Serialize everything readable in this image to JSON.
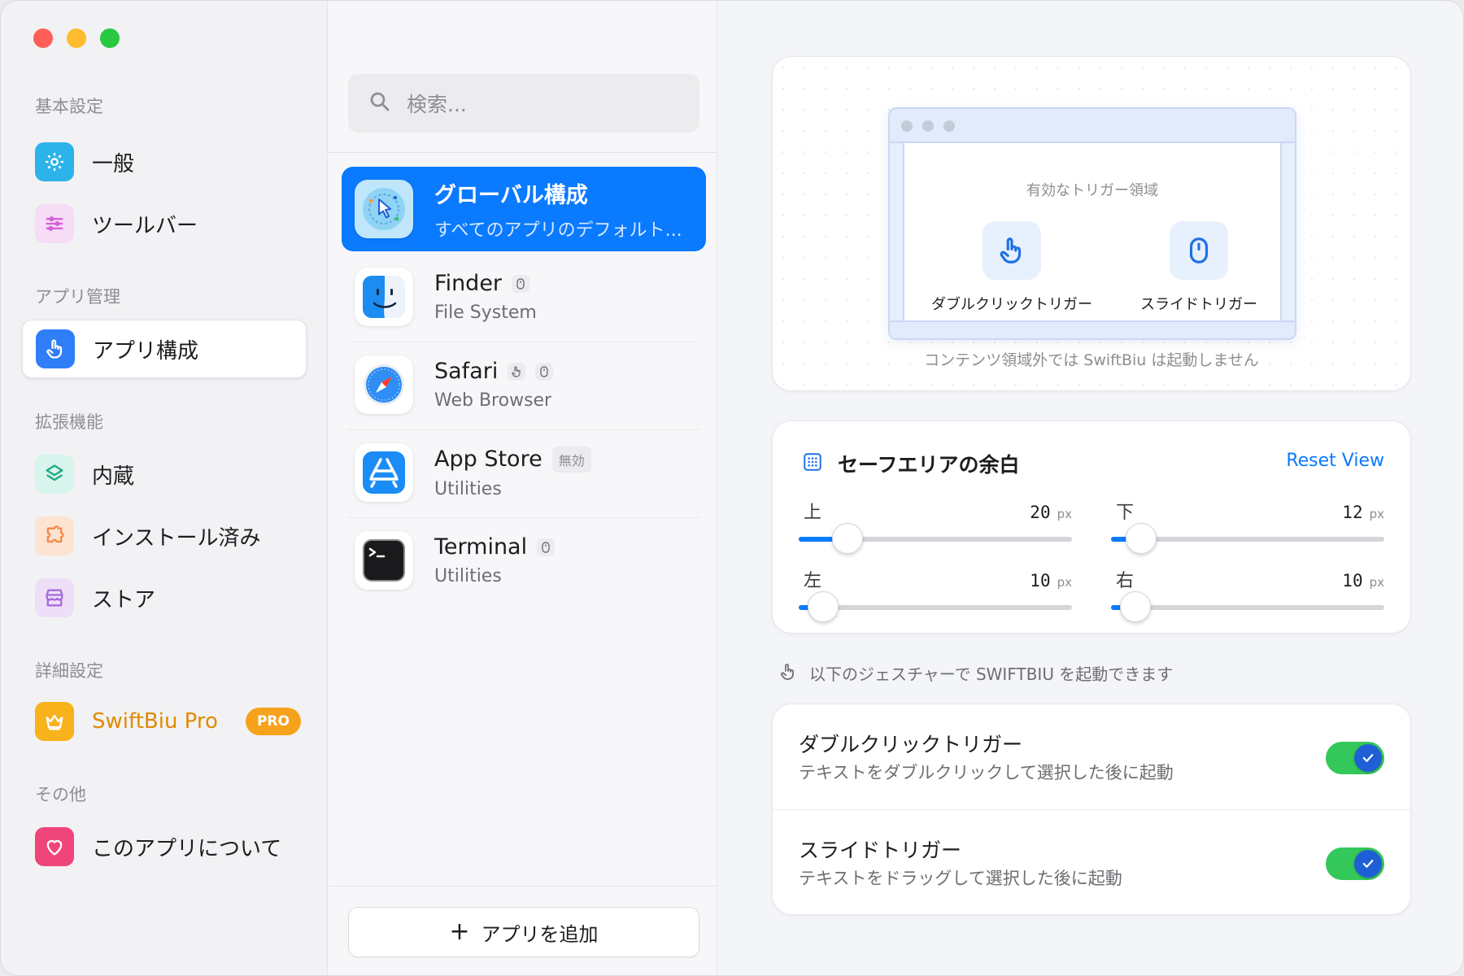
{
  "sidebar": {
    "sections": [
      {
        "label": "基本設定"
      },
      {
        "label": "アプリ管理"
      },
      {
        "label": "拡張機能"
      },
      {
        "label": "詳細設定"
      },
      {
        "label": "その他"
      }
    ],
    "items": [
      {
        "label": "一般",
        "icon": "gear-icon",
        "color": "#2bb3ea"
      },
      {
        "label": "ツールバー",
        "icon": "sliders-icon",
        "color": "#d65fd8"
      },
      {
        "label": "アプリ構成",
        "icon": "hand-pointer-icon",
        "color": "#2f7ef7",
        "active": true
      },
      {
        "label": "内蔵",
        "icon": "layers-icon",
        "color": "#34c7a0"
      },
      {
        "label": "インストール済み",
        "icon": "puzzle-icon",
        "color": "#f6894a"
      },
      {
        "label": "ストア",
        "icon": "storefront-icon",
        "color": "#a66bdc"
      },
      {
        "label": "SwiftBiu Pro",
        "icon": "crown-icon",
        "color": "#f7b21c",
        "badge": "PRO"
      },
      {
        "label": "このアプリについて",
        "icon": "heart-icon",
        "color": "#f0457a"
      }
    ]
  },
  "middle": {
    "search_placeholder": "検索...",
    "apps": [
      {
        "name": "グローバル構成",
        "subtitle": "すべてのアプリのデフォルト...",
        "icon": "global-cursor-icon",
        "selected": true
      },
      {
        "name": "Finder",
        "subtitle": "File System",
        "icon": "finder-icon",
        "badges": [
          "mouse-icon"
        ]
      },
      {
        "name": "Safari",
        "subtitle": "Web Browser",
        "icon": "safari-compass-icon",
        "badges": [
          "hand-pointer-icon",
          "mouse-icon"
        ]
      },
      {
        "name": "App Store",
        "subtitle": "Utilities",
        "icon": "app-store-icon",
        "tag": "無効"
      },
      {
        "name": "Terminal",
        "subtitle": "Utilities",
        "icon": "terminal-icon",
        "badges": [
          "mouse-icon"
        ]
      }
    ],
    "add_button": {
      "label": "アプリを追加"
    }
  },
  "preview": {
    "caption": "有効なトリガー領域",
    "triggers": [
      {
        "label": "ダブルクリックトリガー",
        "icon": "hand-pointer-icon"
      },
      {
        "label": "スライドトリガー",
        "icon": "mouse-icon"
      }
    ],
    "note": "コンテンツ領域外では SwiftBiu は起動しません"
  },
  "safe_area": {
    "title": "セーフエリアの余白",
    "reset_label": "Reset View",
    "unit": "px",
    "sliders": [
      {
        "label": "上",
        "value": "20",
        "fraction": 0.18
      },
      {
        "label": "下",
        "value": "12",
        "fraction": 0.11
      },
      {
        "label": "左",
        "value": "10",
        "fraction": 0.09
      },
      {
        "label": "右",
        "value": "10",
        "fraction": 0.09
      }
    ]
  },
  "gestures": {
    "note": "以下のジェスチャーで SWIFTBIU を起動できます",
    "items": [
      {
        "title": "ダブルクリックトリガー",
        "subtitle": "テキストをダブルクリックして選択した後に起動",
        "enabled": true
      },
      {
        "title": "スライドトリガー",
        "subtitle": "テキストをドラッグして選択した後に起動",
        "enabled": true
      }
    ]
  }
}
